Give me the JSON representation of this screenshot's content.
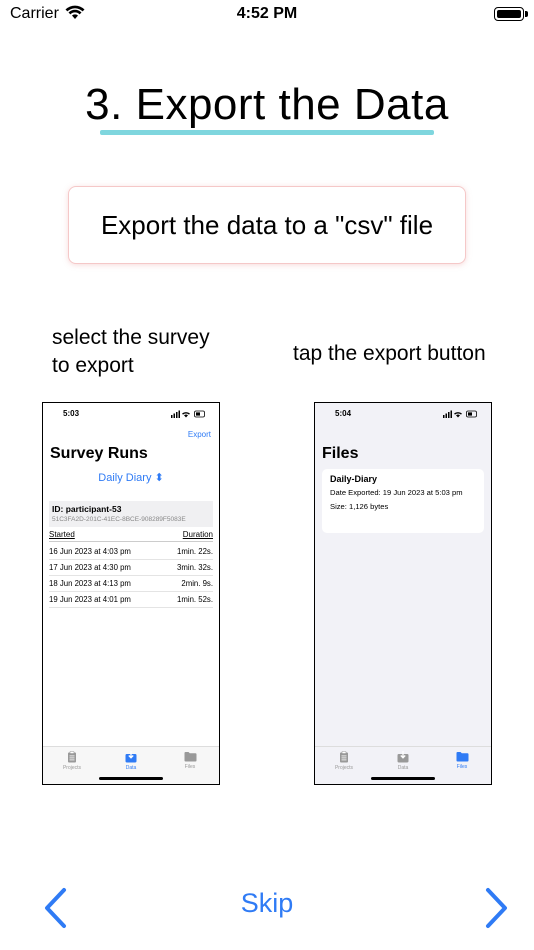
{
  "status_bar": {
    "carrier": "Carrier",
    "time": "4:52 PM"
  },
  "title": "3. Export the Data",
  "subtitle": "Export the data to a \"csv\" file",
  "captions": {
    "left": "select the survey\nto export",
    "right": "tap the export button"
  },
  "left_phone": {
    "time": "5:03",
    "export_label": "Export",
    "title": "Survey Runs",
    "survey_selector": "Daily Diary ⬍",
    "participant_id": "ID: participant-53",
    "participant_uuid": "51C3FA2D-201C-41EC-8BCE-908289F5083E",
    "columns": [
      "Started",
      "Duration"
    ],
    "rows": [
      [
        "16 Jun 2023 at 4:03 pm",
        "1min. 22s."
      ],
      [
        "17 Jun 2023 at 4:30 pm",
        "3min. 32s."
      ],
      [
        "18 Jun 2023 at 4:13 pm",
        "2min. 9s."
      ],
      [
        "19 Jun 2023 at 4:01 pm",
        "1min. 52s."
      ]
    ],
    "tabs": [
      "Projects",
      "Data",
      "Files"
    ],
    "active_tab": "Data"
  },
  "right_phone": {
    "time": "5:04",
    "title": "Files",
    "file_name": "Daily-Diary",
    "date_exported": "Date Exported: 19 Jun 2023 at 5:03 pm",
    "size": "Size: 1,126 bytes",
    "tabs": [
      "Projects",
      "Data",
      "Files"
    ],
    "active_tab": "Files"
  },
  "navigation": {
    "skip_label": "Skip"
  },
  "colors": {
    "accent": "#2f7bf5",
    "underline": "#7fd6de",
    "card_border": "#f5c8c8"
  },
  "icons": [
    "wifi-icon",
    "battery-icon",
    "clipboard-icon",
    "download-tray-icon",
    "folder-icon",
    "chevron-left-icon",
    "chevron-right-icon"
  ]
}
